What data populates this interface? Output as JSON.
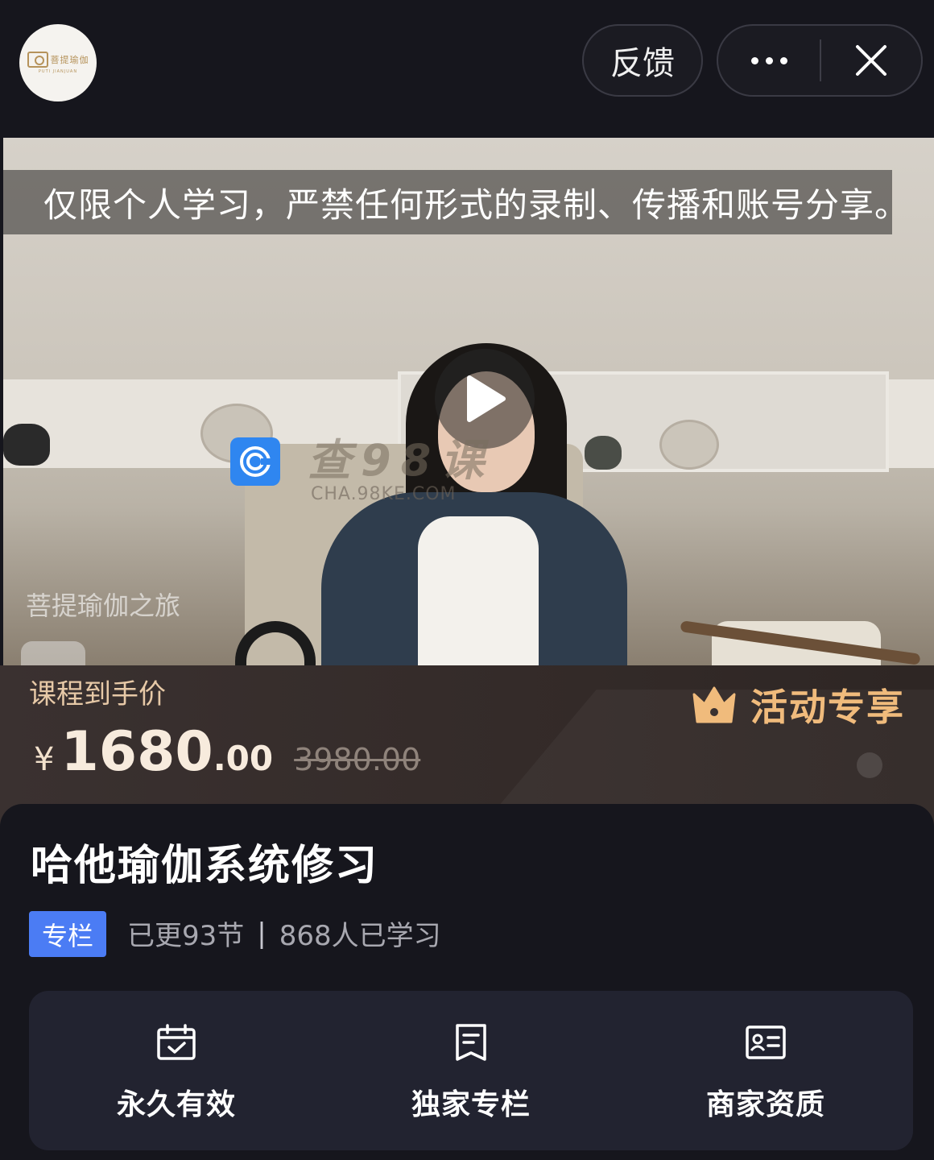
{
  "header": {
    "logo_text": "菩提瑜伽",
    "logo_subtext": "PUTI JIANJUAN",
    "feedback_label": "反馈",
    "more_icon": "ellipsis-icon",
    "close_icon": "close-icon"
  },
  "video": {
    "subtitle": "仅限个人学习，严禁任何形式的录制、传播和账号分享。–",
    "watermark_text": "查98课",
    "watermark_url": "CHA.98KE.COM",
    "channel_mark": "菩提瑜伽之旅",
    "play_icon": "play-icon"
  },
  "price": {
    "label": "课程到手价",
    "currency": "¥",
    "integer": "1680",
    "decimal": ".00",
    "original": "3980.00",
    "activity_label": "活动专享",
    "activity_icon": "crown-icon",
    "accent_color": "#f0bb7c"
  },
  "course": {
    "title": "哈他瑜伽系统修习",
    "tag": "专栏",
    "updated": "已更93节",
    "separator": "|",
    "learners": "868人已学习",
    "tag_color": "#4b7cf4"
  },
  "features": [
    {
      "icon": "calendar-check-icon",
      "label": "永久有效"
    },
    {
      "icon": "bookmark-doc-icon",
      "label": "独家专栏"
    },
    {
      "icon": "id-card-icon",
      "label": "商家资质"
    }
  ]
}
